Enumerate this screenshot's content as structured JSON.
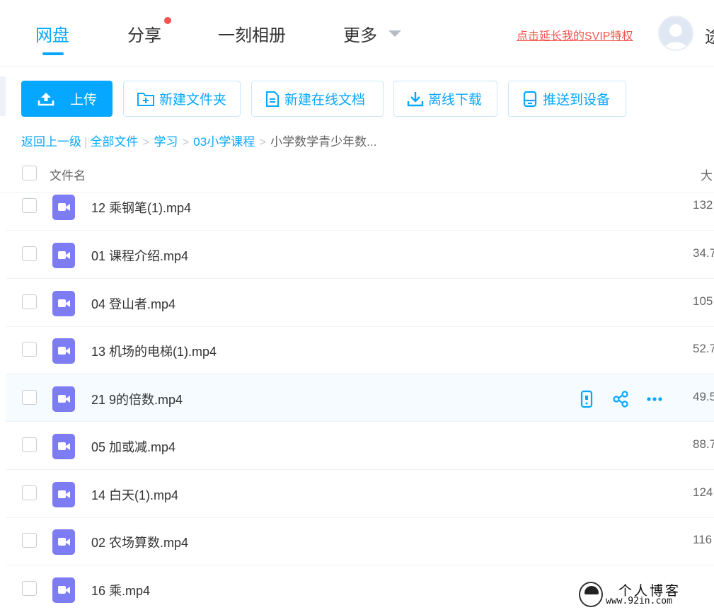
{
  "nav": {
    "tabs": [
      {
        "label": "网盘",
        "active": true
      },
      {
        "label": "分享",
        "active": false,
        "has_badge": true
      },
      {
        "label": "一刻相册",
        "active": false
      },
      {
        "label": "更多",
        "active": false,
        "has_dropdown": true
      }
    ],
    "svip_link": "点击延长我的SVIP特权",
    "username_partial": "途"
  },
  "toolbar": {
    "upload": "上传",
    "new_folder": "新建文件夹",
    "new_doc": "新建在线文档",
    "offline_download": "离线下载",
    "push_device": "推送到设备"
  },
  "breadcrumb": {
    "back": "返回上一级",
    "divider": "|",
    "items": [
      "全部文件",
      "学习",
      "03小学课程"
    ],
    "current": "小学数学青少年数..."
  },
  "table": {
    "col_name": "文件名",
    "col_size": "大",
    "rows": [
      {
        "name": "12 乘钢笔(1).mp4",
        "size": "132"
      },
      {
        "name": "01 课程介绍.mp4",
        "size": "34.7"
      },
      {
        "name": "04 登山者.mp4",
        "size": "105"
      },
      {
        "name": "13 机场的电梯(1).mp4",
        "size": "52.7"
      },
      {
        "name": "21 9的倍数.mp4",
        "size": "49.5",
        "hovered": true
      },
      {
        "name": "05 加或减.mp4",
        "size": "88.7"
      },
      {
        "name": "14 白天(1).mp4",
        "size": "124"
      },
      {
        "name": "02 农场算数.mp4",
        "size": "116"
      },
      {
        "name": "16 乘.mp4",
        "size": ""
      }
    ]
  },
  "watermark": {
    "title": "个人博客",
    "url": "www.92in.com"
  },
  "colors": {
    "accent": "#06a7ff",
    "svip": "#f5544e",
    "video_icon": "#7d7cf2"
  }
}
